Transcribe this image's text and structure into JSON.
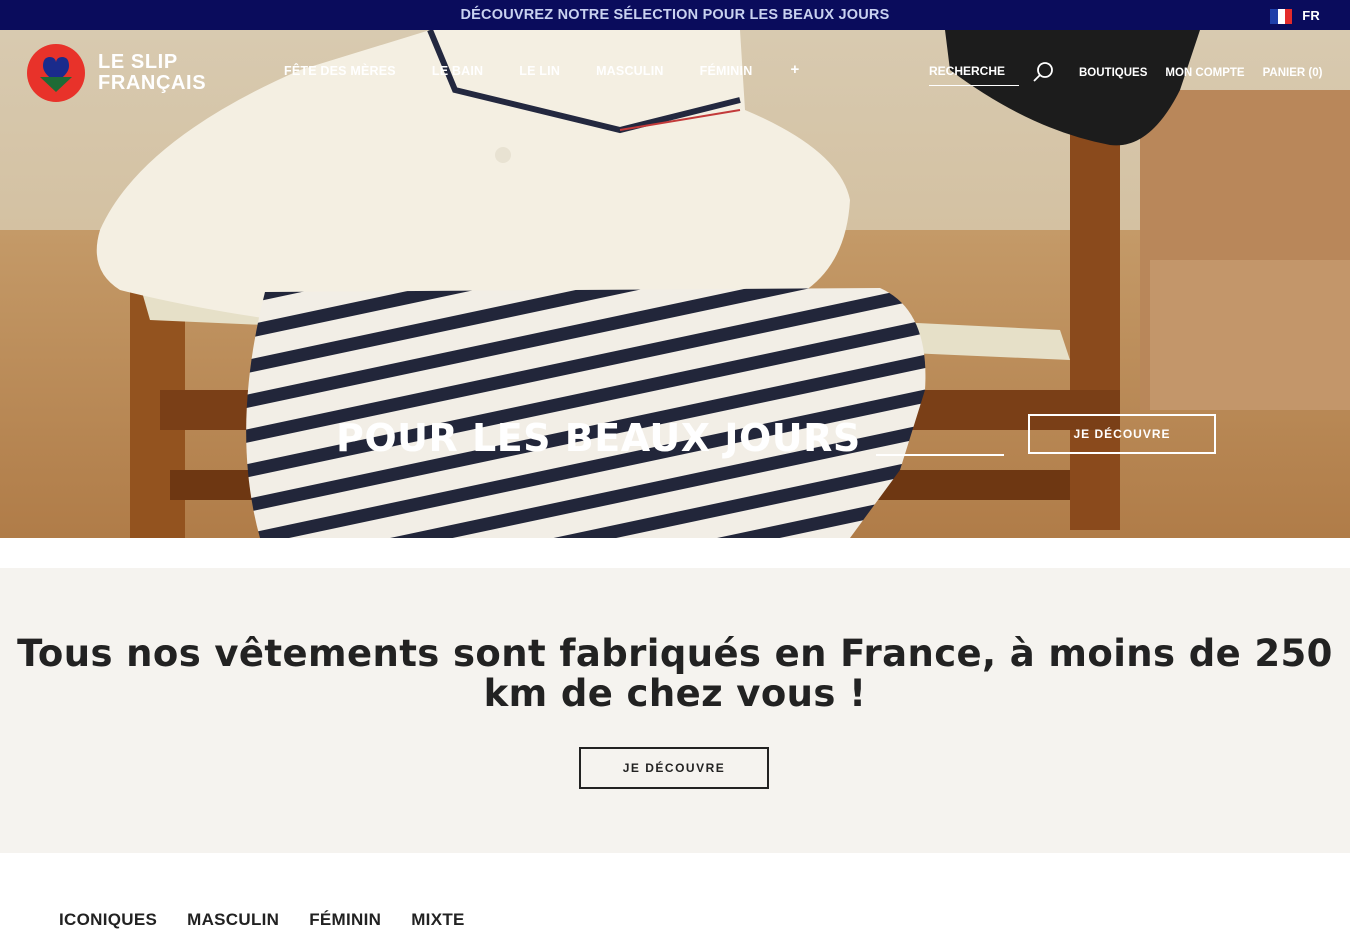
{
  "announcement": {
    "text": "DÉCOUVREZ NOTRE SÉLECTION POUR LES BEAUX JOURS"
  },
  "language": {
    "code": "FR",
    "flag_colors": [
      "#1f3fa8",
      "#ffffff",
      "#e32b2b"
    ]
  },
  "brand": {
    "line1": "LE SLIP",
    "line2": "FRANÇAIS",
    "logo_colors": [
      "#e8322a",
      "#1a2b8c",
      "#1e6b35"
    ]
  },
  "nav": {
    "items": [
      "FÊTE DES MÈRES",
      "LE BAIN",
      "LE LIN",
      "MASCULIN",
      "FÉMININ"
    ],
    "more": "+"
  },
  "search": {
    "label": "RECHERCHE",
    "icon": "search-icon"
  },
  "account": {
    "shops": "BOUTIQUES",
    "account": "MON COMPTE",
    "cart": "PANIER (0)"
  },
  "hero": {
    "title": "POUR LES BEAUX JOURS",
    "cta": "JE DÉCOUVRE"
  },
  "banner": {
    "text": "Tous nos vêtements sont fabriqués en France, à moins de 250 km de chez vous !",
    "cta": "JE DÉCOUVRE"
  },
  "categories": [
    "ICONIQUES",
    "MASCULIN",
    "FÉMININ",
    "MIXTE"
  ],
  "colors": {
    "topbar": "#0a0c5c",
    "banner_bg": "#f5f3ef"
  }
}
